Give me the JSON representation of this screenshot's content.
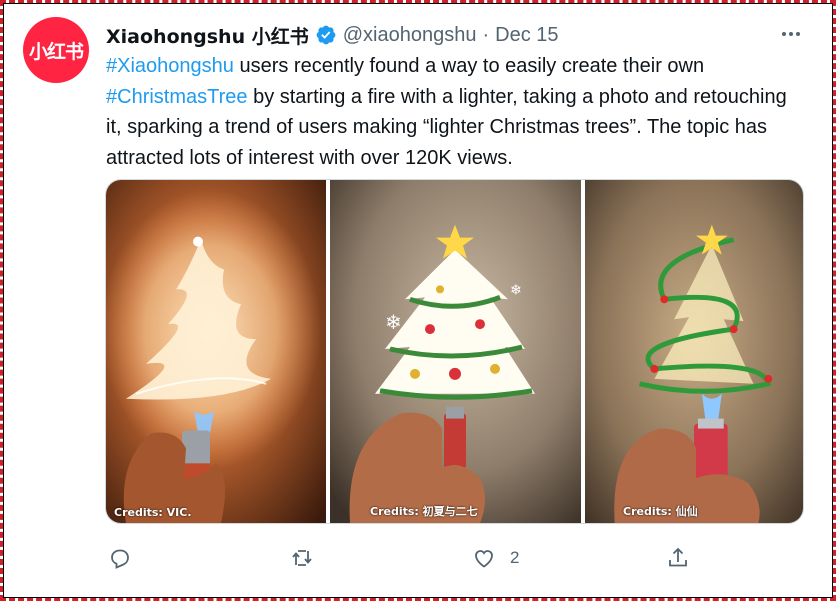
{
  "account": {
    "avatar_text": "小红书",
    "avatar_color": "#ff2442",
    "display_name": "Xiaohongshu 小红书",
    "verified": true,
    "handle": "@xiaohongshu",
    "separator": "·",
    "date": "Dec 15"
  },
  "tweet": {
    "segments": [
      {
        "text": "#Xiaohongshu",
        "type": "hashtag"
      },
      {
        "text": " users recently found a way to easily create their own ",
        "type": "text"
      },
      {
        "text": "#ChristmasTree",
        "type": "hashtag"
      },
      {
        "text": " by starting a fire with a lighter, taking a photo and retouching it, sparking a trend of users making “lighter Christmas trees”. The topic has attracted lots of interest with over 120K views.",
        "type": "text"
      }
    ]
  },
  "media": {
    "photos": [
      {
        "credit": "Credits: VIC.",
        "description": "flame-tree-photo"
      },
      {
        "credit": "Credits: 初夏与二七",
        "description": "decorated-tree-photo"
      },
      {
        "credit": "Credits: 仙仙",
        "description": "ribbon-tree-photo"
      }
    ]
  },
  "actions": {
    "reply": {
      "icon": "reply-icon",
      "count": ""
    },
    "retweet": {
      "icon": "retweet-icon",
      "count": ""
    },
    "like": {
      "icon": "heart-icon",
      "count": "2"
    },
    "share": {
      "icon": "share-icon",
      "count": ""
    }
  },
  "colors": {
    "hashtag": "#1d9bf0",
    "secondary_text": "#536471",
    "primary_text": "#0f1419",
    "verified": "#1d9bf0",
    "frame": "#d0202a"
  }
}
